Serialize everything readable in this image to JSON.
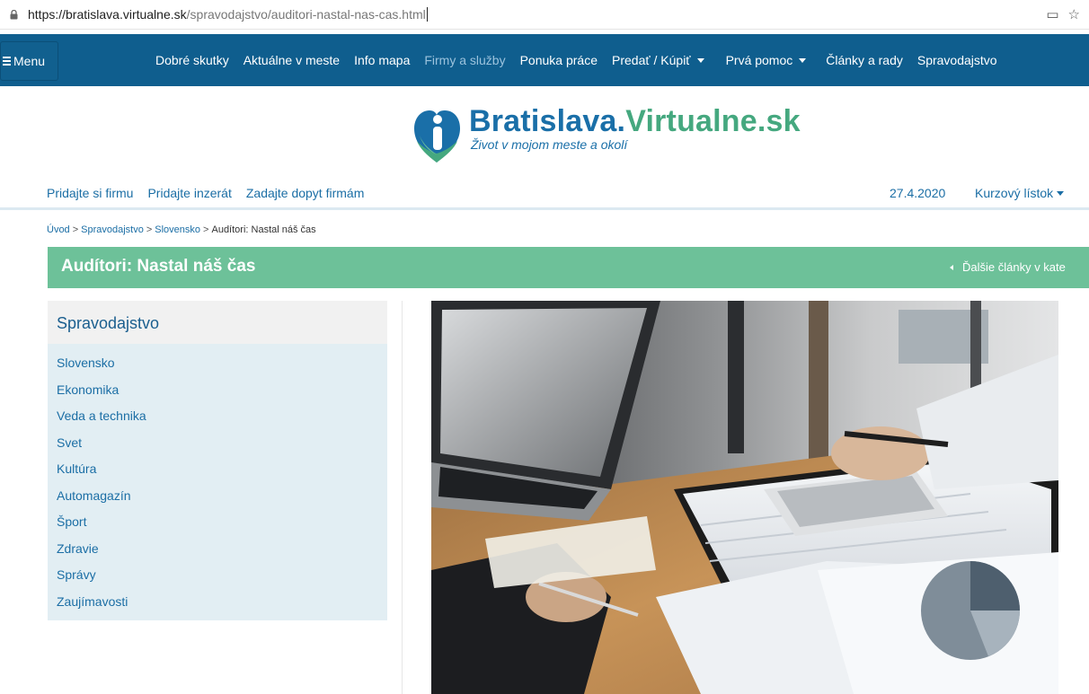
{
  "browser": {
    "url_host": "https://bratislava.virtualne.sk",
    "url_path": "/spravodajstvo/auditori-nastal-nas-cas.html"
  },
  "nav": {
    "menu_label": "Menu",
    "items": [
      {
        "label": "Dobré skutky"
      },
      {
        "label": "Aktuálne v meste"
      },
      {
        "label": "Info mapa"
      },
      {
        "label": "Firmy a služby"
      },
      {
        "label": "Ponuka práce"
      },
      {
        "label": "Predať / Kúpiť"
      },
      {
        "label": "Prvá pomoc"
      },
      {
        "label": "Články a rady"
      },
      {
        "label": "Spravodajstvo"
      }
    ]
  },
  "logo": {
    "title_main": "Bratislava.",
    "title_accent": "Virtualne.sk",
    "tagline": "Život v mojom meste a okolí"
  },
  "subbar": {
    "links": [
      {
        "label": "Pridajte si firmu"
      },
      {
        "label": "Pridajte inzerát"
      },
      {
        "label": "Zadajte dopyt firmám"
      }
    ],
    "date": "27.4.2020",
    "currency_label": "Kurzový lístok"
  },
  "breadcrumb": {
    "items": [
      "Úvod",
      "Spravodajstvo",
      "Slovensko"
    ],
    "current": "Audítori: Nastal náš čas",
    "separator": ">"
  },
  "article": {
    "title": "Audítori: Nastal náš čas",
    "more_label": "Ďalšie články v kate"
  },
  "sidebar": {
    "heading": "Spravodajstvo",
    "items": [
      {
        "label": "Slovensko"
      },
      {
        "label": "Ekonomika"
      },
      {
        "label": "Veda a technika"
      },
      {
        "label": "Svet"
      },
      {
        "label": "Kultúra"
      },
      {
        "label": "Automagazín"
      },
      {
        "label": "Šport"
      },
      {
        "label": "Zdravie"
      },
      {
        "label": "Správy"
      },
      {
        "label": "Zaujímavosti"
      }
    ]
  },
  "colors": {
    "nav_bg": "#0f5e8e",
    "title_bar": "#6dc199",
    "link": "#1b6ea5",
    "sidebar_bg": "#e2eef3"
  }
}
